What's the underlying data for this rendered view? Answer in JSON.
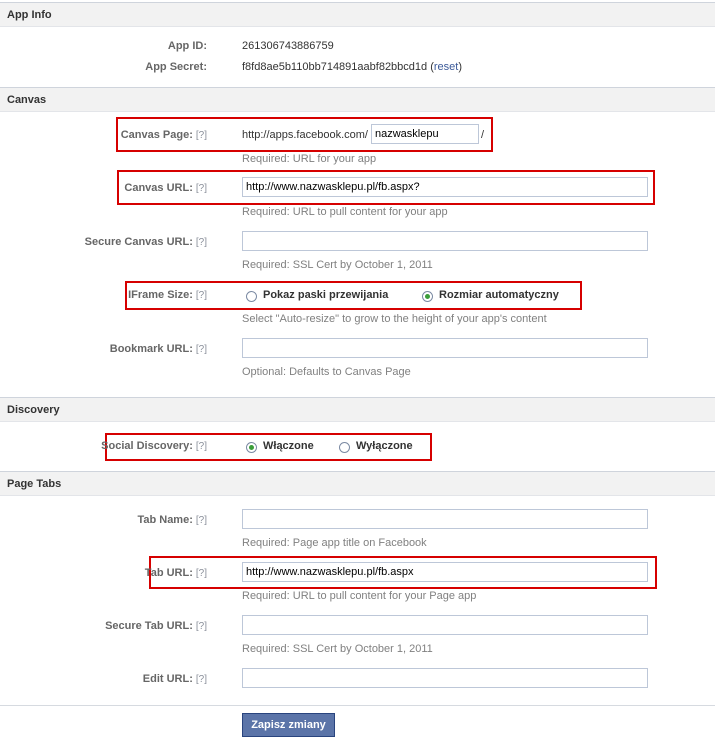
{
  "app_info": {
    "header": "App Info",
    "app_id_label": "App ID:",
    "app_id": "261306743886759",
    "app_secret_label": "App Secret:",
    "app_secret": "f8fd8ae5b110bb714891aabf82bbcd1d",
    "reset_open": "(",
    "reset_link": "reset",
    "reset_close": ")"
  },
  "canvas": {
    "header": "Canvas",
    "help": "[?]",
    "canvas_page_label": "Canvas Page:",
    "canvas_page_prefix": "http://apps.facebook.com/",
    "canvas_page_value": "nazwasklepu",
    "canvas_page_suffix": "/",
    "canvas_page_hint": "Required: URL for your app",
    "canvas_url_label": "Canvas URL:",
    "canvas_url_value": "http://www.nazwasklepu.pl/fb.aspx?",
    "canvas_url_hint": "Required: URL to pull content for your app",
    "secure_canvas_label": "Secure Canvas URL:",
    "secure_canvas_value": "",
    "secure_canvas_hint": "Required: SSL Cert by October 1, 2011",
    "iframe_label": "IFrame Size:",
    "iframe_opt1": "Pokaz paski przewijania",
    "iframe_opt2": "Rozmiar automatyczny",
    "iframe_selected": "Rozmiar automatyczny",
    "iframe_hint": "Select \"Auto-resize\" to grow to the height of your app's content",
    "bookmark_label": "Bookmark URL:",
    "bookmark_value": "",
    "bookmark_hint": "Optional: Defaults to Canvas Page"
  },
  "discovery": {
    "header": "Discovery",
    "social_label": "Social Discovery:",
    "opt_on": "Włączone",
    "opt_off": "Wyłączone",
    "selected": "Włączone"
  },
  "page_tabs": {
    "header": "Page Tabs",
    "tab_name_label": "Tab Name:",
    "tab_name_value": "",
    "tab_name_hint": "Required: Page app title on Facebook",
    "tab_url_label": "Tab URL:",
    "tab_url_value": "http://www.nazwasklepu.pl/fb.aspx",
    "tab_url_hint": "Required: URL to pull content for your Page app",
    "secure_tab_label": "Secure Tab URL:",
    "secure_tab_value": "",
    "secure_tab_hint": "Required: SSL Cert by October 1, 2011",
    "edit_url_label": "Edit URL:",
    "edit_url_value": ""
  },
  "save_button": "Zapisz zmiany",
  "colors": {
    "highlight": "#d60000",
    "link": "#3b5998",
    "button": "#5b74a8",
    "radio_on": "#3a9d3a"
  }
}
